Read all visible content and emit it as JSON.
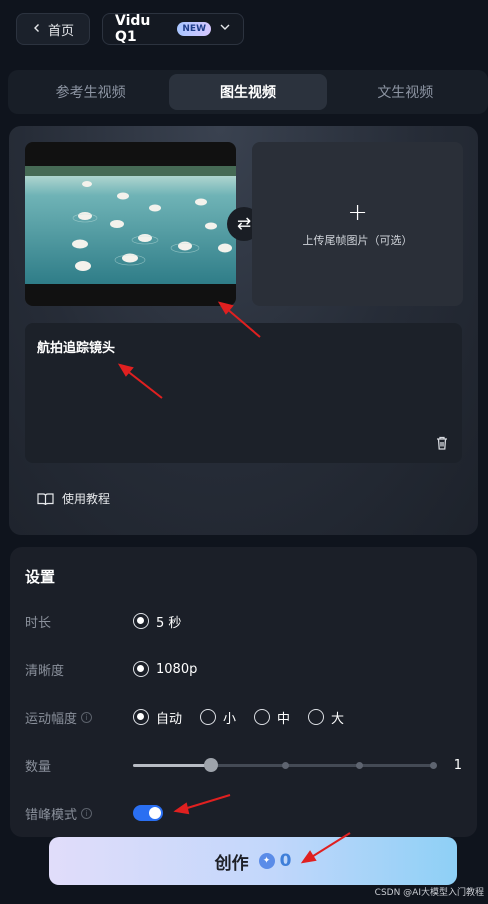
{
  "header": {
    "home_label": "首页",
    "model_name": "Vidu Q1",
    "new_badge": "NEW"
  },
  "tabs": [
    {
      "label": "参考生视频",
      "active": false
    },
    {
      "label": "图生视频",
      "active": true
    },
    {
      "label": "文生视频",
      "active": false
    }
  ],
  "upload": {
    "last_frame_label": "上传尾帧图片（可选）"
  },
  "prompt": {
    "text": "航拍追踪镜头"
  },
  "tutorial_label": "使用教程",
  "settings": {
    "title": "设置",
    "duration": {
      "label": "时长",
      "options": [
        "5 秒"
      ],
      "selected": "5 秒"
    },
    "resolution": {
      "label": "清晰度",
      "options": [
        "1080p"
      ],
      "selected": "1080p"
    },
    "motion": {
      "label": "运动幅度",
      "options": [
        "自动",
        "小",
        "中",
        "大"
      ],
      "selected": "自动"
    },
    "count": {
      "label": "数量",
      "value": "1",
      "min": 1,
      "max": 4,
      "current": 1
    },
    "offpeak": {
      "label": "错峰模式",
      "enabled": true
    }
  },
  "create": {
    "label": "创作",
    "credits": "0"
  },
  "watermark": "CSDN @AI大模型入门教程",
  "colors": {
    "accent": "#2a6ff2",
    "annotation": "#e02020"
  }
}
